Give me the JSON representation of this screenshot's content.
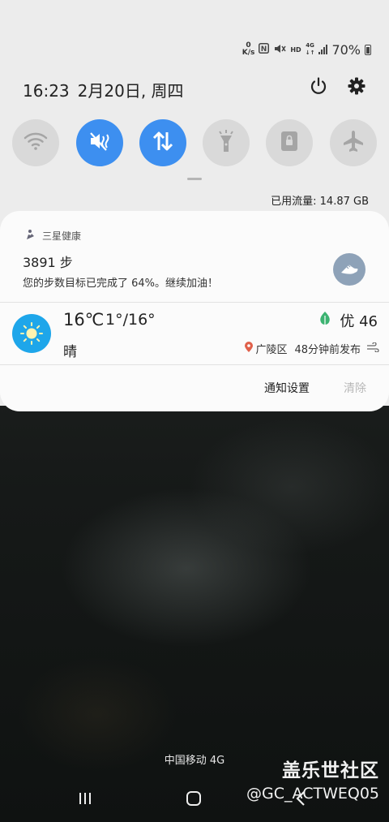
{
  "status_bar": {
    "net_speed_value": "0",
    "net_speed_unit": "K/s",
    "nfc_icon": "nfc-icon",
    "mute_icon": "vibrate-mute-icon",
    "hd_label": "HD",
    "network_type": "4G",
    "battery_percent": "70%"
  },
  "header": {
    "time": "16:23",
    "date": "2月20日, 周四",
    "power_icon": "power-icon",
    "settings_icon": "gear-icon"
  },
  "quick_tiles": [
    {
      "name": "wifi",
      "icon": "wifi-icon",
      "active": false
    },
    {
      "name": "sound-mute",
      "icon": "vibrate-mute-icon",
      "active": true
    },
    {
      "name": "mobile-data",
      "icon": "data-arrows-icon",
      "active": true
    },
    {
      "name": "flashlight",
      "icon": "flashlight-icon",
      "active": false
    },
    {
      "name": "screen-lock",
      "icon": "lock-icon",
      "active": false
    },
    {
      "name": "airplane",
      "icon": "airplane-icon",
      "active": false
    }
  ],
  "data_usage": "已用流量: 14.87 GB",
  "notifications": {
    "health": {
      "app_name": "三星健康",
      "title": "3891 步",
      "message": "您的步数目标已完成了 64%。继续加油！"
    },
    "weather": {
      "temperature": "16℃",
      "range": "1°/16°",
      "condition": "晴",
      "aqi": "优 46",
      "location": "广陵区",
      "updated": "48分钟前发布"
    },
    "actions": {
      "settings": "通知设置",
      "clear": "清除"
    }
  },
  "footer": {
    "carrier": "中国移动 4G",
    "watermark_title": "盖乐世社区",
    "watermark_user": "@GC_ACTWEQ05"
  },
  "colors": {
    "accent": "#3d8ff0",
    "weather_icon_bg": "#1ea6ea",
    "aqi_leaf": "#3cb371",
    "shade_bg": "#ececec"
  }
}
